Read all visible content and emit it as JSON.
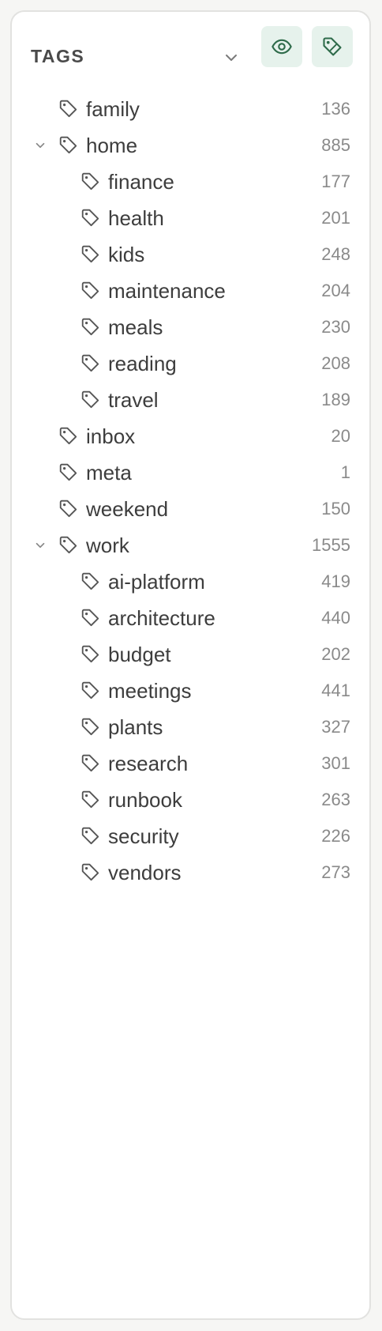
{
  "panel": {
    "title": "TAGS",
    "accent": "#2e6b4a",
    "accent_bg": "#e6f2ec"
  },
  "tags": [
    {
      "label": "family",
      "count": "136",
      "level": 0,
      "expanded": false
    },
    {
      "label": "home",
      "count": "885",
      "level": 0,
      "expanded": true
    },
    {
      "label": "finance",
      "count": "177",
      "level": 1
    },
    {
      "label": "health",
      "count": "201",
      "level": 1
    },
    {
      "label": "kids",
      "count": "248",
      "level": 1
    },
    {
      "label": "maintenance",
      "count": "204",
      "level": 1
    },
    {
      "label": "meals",
      "count": "230",
      "level": 1
    },
    {
      "label": "reading",
      "count": "208",
      "level": 1
    },
    {
      "label": "travel",
      "count": "189",
      "level": 1
    },
    {
      "label": "inbox",
      "count": "20",
      "level": 0,
      "expanded": false
    },
    {
      "label": "meta",
      "count": "1",
      "level": 0,
      "expanded": false
    },
    {
      "label": "weekend",
      "count": "150",
      "level": 0,
      "expanded": false
    },
    {
      "label": "work",
      "count": "1555",
      "level": 0,
      "expanded": true
    },
    {
      "label": "ai-platform",
      "count": "419",
      "level": 1
    },
    {
      "label": "architecture",
      "count": "440",
      "level": 1
    },
    {
      "label": "budget",
      "count": "202",
      "level": 1
    },
    {
      "label": "meetings",
      "count": "441",
      "level": 1
    },
    {
      "label": "plants",
      "count": "327",
      "level": 1
    },
    {
      "label": "research",
      "count": "301",
      "level": 1
    },
    {
      "label": "runbook",
      "count": "263",
      "level": 1
    },
    {
      "label": "security",
      "count": "226",
      "level": 1
    },
    {
      "label": "vendors",
      "count": "273",
      "level": 1
    }
  ]
}
